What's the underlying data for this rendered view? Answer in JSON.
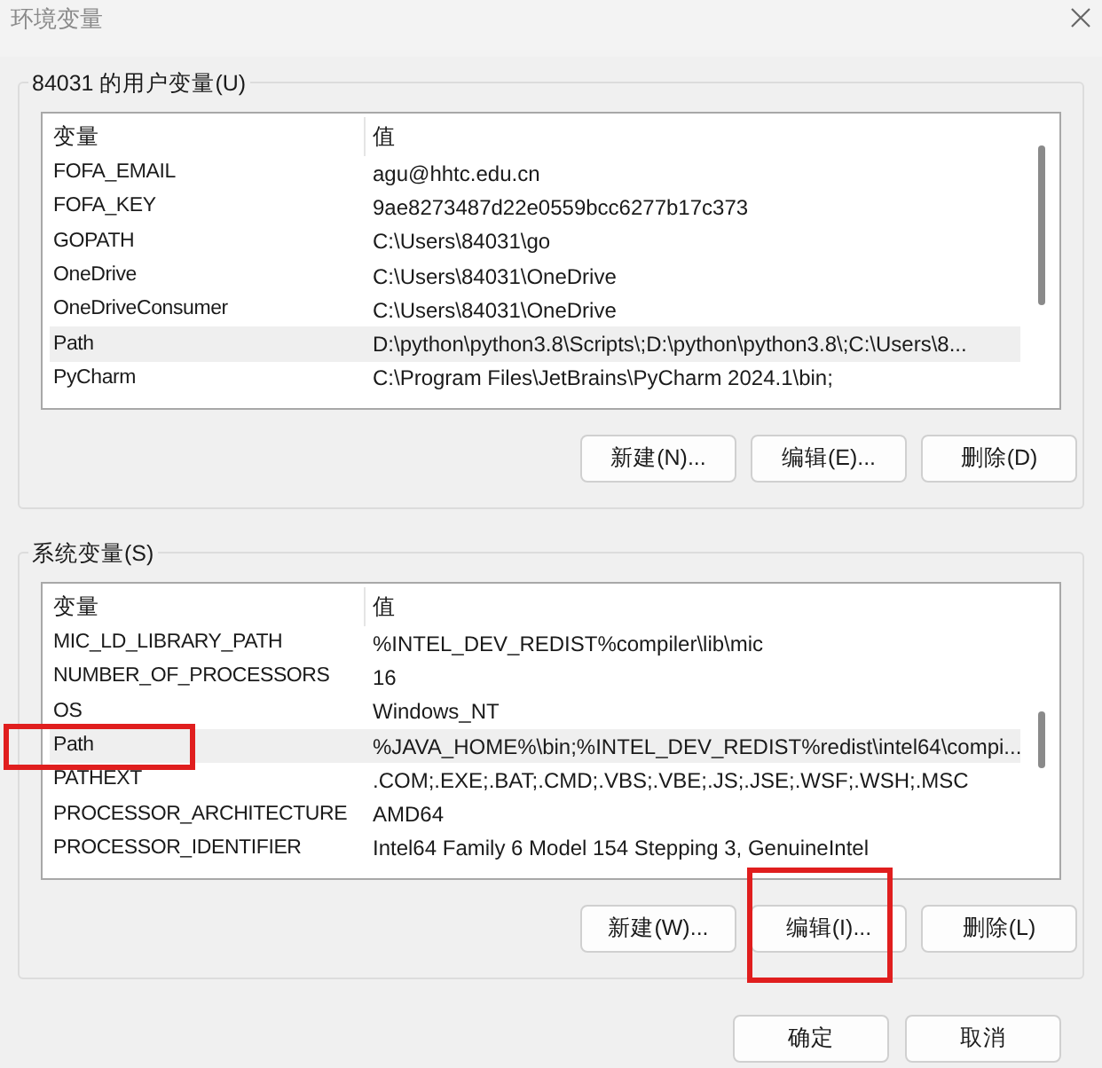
{
  "window": {
    "title": "环境变量"
  },
  "user_variables": {
    "title": "84031 的用户变量(U)",
    "columns": [
      "变量",
      "值"
    ],
    "rows": [
      {
        "name": "FOFA_EMAIL",
        "value": "agu@hhtc.edu.cn",
        "selected": false,
        "marked": false
      },
      {
        "name": "FOFA_KEY",
        "value": "9ae8273487d22e0559bcc6277b17c373",
        "selected": false,
        "marked": false
      },
      {
        "name": "GOPATH",
        "value": "C:\\Users\\84031\\go",
        "selected": false,
        "marked": false
      },
      {
        "name": "OneDrive",
        "value": "C:\\Users\\84031\\OneDrive",
        "selected": false,
        "marked": false
      },
      {
        "name": "OneDriveConsumer",
        "value": "C:\\Users\\84031\\OneDrive",
        "selected": false,
        "marked": false
      },
      {
        "name": "Path",
        "value": "D:\\python\\python3.8\\Scripts\\;D:\\python\\python3.8\\;C:\\Users\\8...",
        "selected": true,
        "marked": false
      },
      {
        "name": "PyCharm",
        "value": "C:\\Program Files\\JetBrains\\PyCharm 2024.1\\bin;",
        "selected": false,
        "marked": false
      }
    ],
    "buttons": [
      {
        "label": "新建(N)...",
        "marked": false
      },
      {
        "label": "编辑(E)...",
        "marked": false
      },
      {
        "label": "删除(D)",
        "marked": false
      }
    ]
  },
  "system_variables": {
    "title": "系统变量(S)",
    "columns": [
      "变量",
      "值"
    ],
    "rows": [
      {
        "name": "MIC_LD_LIBRARY_PATH",
        "value": "%INTEL_DEV_REDIST%compiler\\lib\\mic",
        "selected": false,
        "marked": false
      },
      {
        "name": "NUMBER_OF_PROCESSORS",
        "value": "16",
        "selected": false,
        "marked": false
      },
      {
        "name": "OS",
        "value": "Windows_NT",
        "selected": false,
        "marked": false
      },
      {
        "name": "Path",
        "value": "%JAVA_HOME%\\bin;%INTEL_DEV_REDIST%redist\\intel64\\compi...",
        "selected": true,
        "marked": true
      },
      {
        "name": "PATHEXT",
        "value": ".COM;.EXE;.BAT;.CMD;.VBS;.VBE;.JS;.JSE;.WSF;.WSH;.MSC",
        "selected": false,
        "marked": false
      },
      {
        "name": "PROCESSOR_ARCHITECTURE",
        "value": "AMD64",
        "selected": false,
        "marked": false
      },
      {
        "name": "PROCESSOR_IDENTIFIER",
        "value": "Intel64 Family 6 Model 154 Stepping 3, GenuineIntel",
        "selected": false,
        "marked": false
      }
    ],
    "buttons": [
      {
        "label": "新建(W)...",
        "marked": false
      },
      {
        "label": "编辑(I)...",
        "marked": true
      },
      {
        "label": "删除(L)",
        "marked": false
      }
    ]
  },
  "dialog_buttons": [
    {
      "label": "确定",
      "marked": false
    },
    {
      "label": "取消",
      "marked": false
    }
  ]
}
